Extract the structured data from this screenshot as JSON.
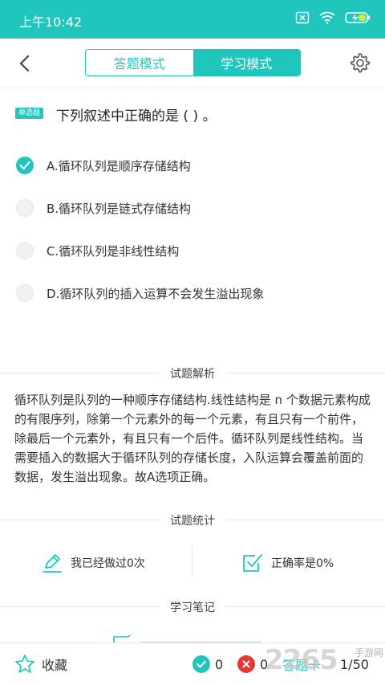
{
  "status_bar": {
    "time": "上午10:42",
    "icons": [
      "sim-blocked-icon",
      "wifi-icon",
      "battery-charging-icon"
    ]
  },
  "nav": {
    "tabs": [
      {
        "label": "答题模式",
        "active": false
      },
      {
        "label": "学习模式",
        "active": true
      }
    ],
    "back_icon": "chevron-left-icon",
    "settings_icon": "gear-icon"
  },
  "question": {
    "type_badge": "单选题",
    "text": "下列叙述中正确的是 ( ) 。",
    "options": [
      {
        "label": "A.循环队列是顺序存储结构",
        "selected": true
      },
      {
        "label": "B.循环队列是链式存储结构",
        "selected": false
      },
      {
        "label": "C.循环队列是非线性结构",
        "selected": false
      },
      {
        "label": "D.循环队列的插入运算不会发生溢出现象",
        "selected": false
      }
    ]
  },
  "analysis": {
    "title": "试题解析",
    "text": "循环队列是队列的一种顺序存储结构.线性结构是 n 个数据元素构成的有限序列，除第一个元素外的每一个元素，有且只有一个前件，除最后一个元素外，有且只有一个后件。循环队列是线性结构。当需要插入的数据大于循环队列的存储长度，入队运算会覆盖前面的数据，发生溢出现象。故A选项正确。"
  },
  "stats": {
    "title": "试题统计",
    "done_text": "我已经做过0次",
    "accuracy_text": "正确率是0%"
  },
  "notes": {
    "title": "学习笔记"
  },
  "bottom_bar": {
    "favorite_label": "收藏",
    "correct_count": "0",
    "wrong_count": "0",
    "answer_card_label": "答题卡",
    "progress": "1/50"
  },
  "watermark": {
    "number": "2265",
    "name": "手游网"
  },
  "colors": {
    "accent": "#1fc6be",
    "correct": "#1fc6be",
    "wrong": "#e53935"
  }
}
